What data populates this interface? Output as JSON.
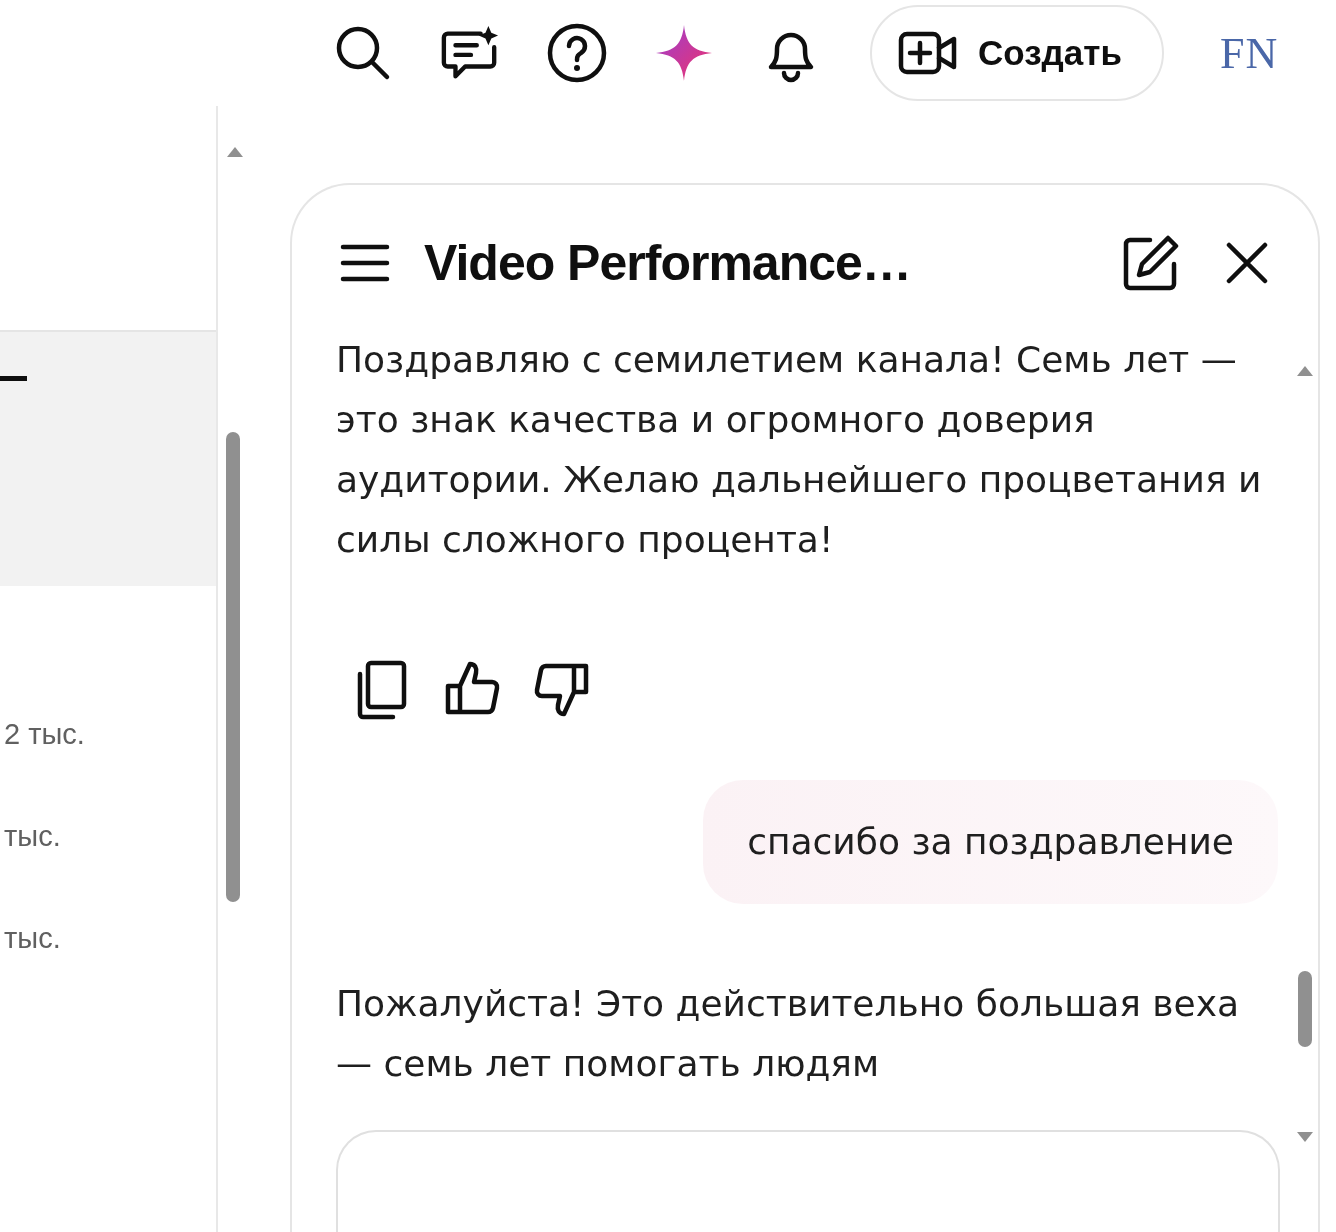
{
  "create_button": {
    "label": "Создать"
  },
  "account": {
    "initials": "FN"
  },
  "left_panel": {
    "rows": [
      {
        "value": "2 тыс."
      },
      {
        "value": "тыс."
      },
      {
        "value": "тыс."
      }
    ]
  },
  "chat": {
    "title": "Video Performance…",
    "messages": [
      {
        "kind": "assistant",
        "text": "Поздравляю с семилетием канала! Семь лет — это знак качества и огромного доверия аудитории. Желаю дальнейшего процветания и силы сложного процента!"
      },
      {
        "kind": "actions"
      },
      {
        "kind": "user",
        "text": "спасибо за поздравление"
      },
      {
        "kind": "assistant",
        "text": "Пожалуйста! Это действительно большая веха — семь лет помогать людям"
      }
    ]
  }
}
